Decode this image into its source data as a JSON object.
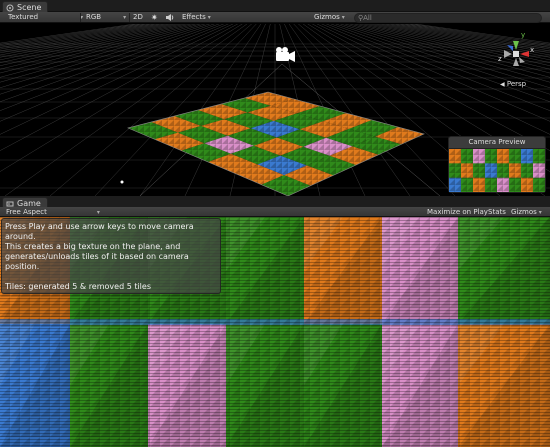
{
  "scene_window": {
    "tab_label": "Scene",
    "toolbar": {
      "render_mode": "Textured",
      "color_mode": "RGB",
      "mode_2d": "2D",
      "effects_label": "Effects",
      "gizmos_label": "Gizmos",
      "search_placeholder": "All"
    },
    "gizmo_axes": {
      "x": "x",
      "y": "y",
      "z": "z"
    },
    "projection_label": "Persp",
    "camera_preview": {
      "title": "Camera Preview"
    }
  },
  "game_window": {
    "tab_label": "Game",
    "toolbar": {
      "aspect_label": "Free Aspect",
      "maximize_label": "Maximize on Play",
      "stats_label": "Stats",
      "gizmos_label": "Gizmos"
    },
    "overlay": {
      "line1": "Press Play and use arrow keys to move camera around.",
      "line2": "This creates a big texture on the plane, and",
      "line3": "generates/unloads tiles of it based on camera position.",
      "status": "Tiles: generated 5 & removed 5 tiles"
    }
  },
  "colors": {
    "tile_green": "#2f8a1a",
    "tile_orange": "#e07a1c",
    "tile_pink": "#d98fc8",
    "tile_blue": "#3a7ad0",
    "grid_line": "#6a6a6a",
    "panel_bg": "#3c3c3c"
  }
}
